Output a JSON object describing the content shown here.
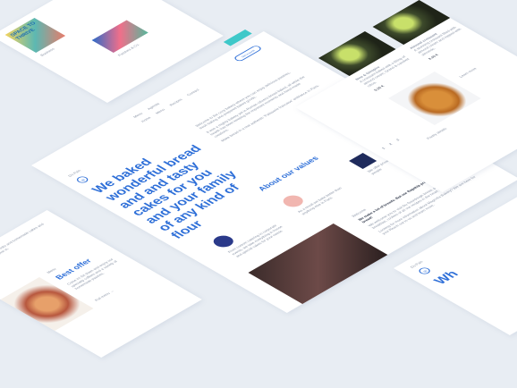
{
  "left_top": {
    "book_title": "SPACE TO THRIVE",
    "book_caption": "Business",
    "item_label": "Pandora & Co."
  },
  "main_card": {
    "nav": [
      "Menu",
      "Agenda"
    ],
    "subnav": [
      "Home",
      "Menu",
      "Recipes",
      "Contact"
    ],
    "nav_button": "Get in touch",
    "logo": "Du Pain",
    "headline": "We baked wonderful bread and and tasty cakes for you and your family of any kind of flour",
    "intro": [
      "Welcome to the cozy bakery where you can enjoy delicious pastries, fresh baking and prepared baked goods.",
      "It was a mighty bakery yet in Roman citizens bread baked, all while the hearth has been keeping the important moments and hand-made creations.",
      "Make bread in a real authentic 'Patisserie francaise' ambiance in Paris."
    ],
    "values_title": "About our values",
    "values": [
      "From custom catering to corporate events, we take everything in house and special cakes for your needs",
      "As a result we bake better than anything else in Paris",
      "We offer private classes starting at 4 people"
    ],
    "section_label": "Welcome",
    "section_text": [
      "We make a lot of breads. But our flagship product is our Baguette bread!",
      "We welcome you to visit Du Sourdough bread, pastry, cakes or a fine breakfast, cookies of all our recipes in the heart of Paris.",
      "Looking for more information about Magnolia Bakery? We are here for you! Reach out to us and learn more."
    ]
  },
  "left_card": {
    "intro_text": "Fresh coffee drinks and homemade cakes and pastries. Come in.",
    "label": "Menu",
    "offer_title": "Best offer",
    "offer_text": "Come in! Sit down and enjoy our specialty coffees and a variety of homemade pastries.",
    "link": "Full menu →"
  },
  "right_card": {
    "product1_name": "New & Ginspire",
    "product1_desc": "A croissant baked with a filling of almond cream, Grand & candied citrus.",
    "product1_price": "9,25 €",
    "product2_name": "Almond croissant",
    "product2_desc": "A stunning croissant filled with almond cream and topped with almonds.",
    "product2_price": "8,40 €",
    "link": "Learn more",
    "pager": "1 2 3",
    "caption": "Pastry details"
  },
  "right_bottom": {
    "logo": "Du Pain",
    "headline": "Wh"
  },
  "colors": {
    "accent": "#2e6fd8",
    "teal": "#3ec8c9",
    "background": "#e8edf3"
  }
}
